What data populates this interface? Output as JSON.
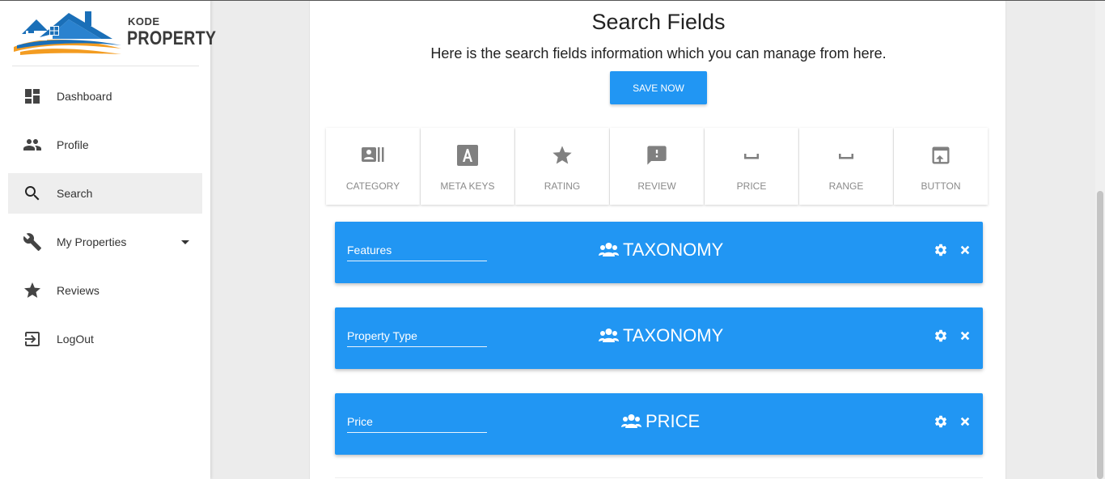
{
  "brand": {
    "line1": "KODE",
    "line2": "PROPERTY"
  },
  "sidebar": {
    "items": [
      {
        "label": "Dashboard",
        "icon": "dashboard-icon"
      },
      {
        "label": "Profile",
        "icon": "people-icon"
      },
      {
        "label": "Search",
        "icon": "search-icon",
        "active": true
      },
      {
        "label": "My Properties",
        "icon": "wrench-icon",
        "has_dropdown": true
      },
      {
        "label": "Reviews",
        "icon": "star-icon"
      },
      {
        "label": "LogOut",
        "icon": "logout-icon"
      }
    ]
  },
  "header": {
    "title": "Search Fields",
    "subtitle": "Here is the search fields information which you can manage from here.",
    "save_label": "SAVE NOW"
  },
  "field_types": [
    {
      "label": "CATEGORY",
      "icon": "category-icon"
    },
    {
      "label": "META KEYS",
      "icon": "meta-keys-icon"
    },
    {
      "label": "RATING",
      "icon": "star-icon"
    },
    {
      "label": "REVIEW",
      "icon": "review-icon"
    },
    {
      "label": "PRICE",
      "icon": "space-bar-icon"
    },
    {
      "label": "RANGE",
      "icon": "space-bar-icon"
    },
    {
      "label": "BUTTON",
      "icon": "upload-icon"
    }
  ],
  "fields": [
    {
      "name": "Features",
      "type": "TAXONOMY"
    },
    {
      "name": "Property Type",
      "type": "TAXONOMY"
    },
    {
      "name": "Price",
      "type": "PRICE"
    }
  ],
  "colors": {
    "accent": "#2196f3",
    "logo_blue": "#1a6fb8",
    "logo_orange": "#f39c21"
  }
}
